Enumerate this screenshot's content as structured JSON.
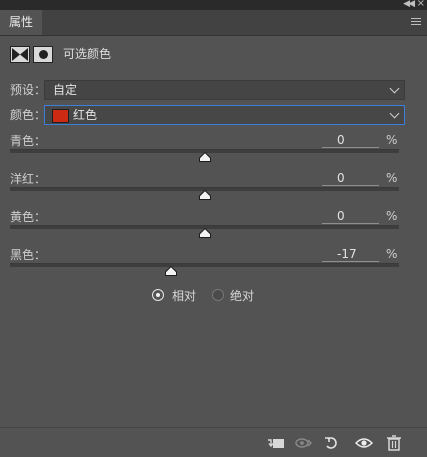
{
  "panel": {
    "tab_label": "属性",
    "title": "可选颜色"
  },
  "preset": {
    "label": "预设：",
    "value": "自定"
  },
  "colors": {
    "label": "颜色：",
    "value": "红色",
    "swatch_color": "#cc2a12"
  },
  "sliders": [
    {
      "label": "青色：",
      "value": "0",
      "unit": "%",
      "level_percent": 50
    },
    {
      "label": "洋红：",
      "value": "0",
      "unit": "%",
      "level_percent": 50
    },
    {
      "label": "黄色：",
      "value": "0",
      "unit": "%",
      "level_percent": 50
    },
    {
      "label": "黑色：",
      "value": "-17",
      "unit": "%",
      "level_percent": 41.5
    }
  ],
  "method": {
    "relative_label": "相对",
    "absolute_label": "绝对",
    "selected": "relative"
  },
  "footer_icons": [
    "clip-to-layer-icon",
    "view-previous-state-icon",
    "reset-icon",
    "visibility-eye-icon",
    "trash-icon"
  ],
  "accent_color": "#3c7fd9"
}
